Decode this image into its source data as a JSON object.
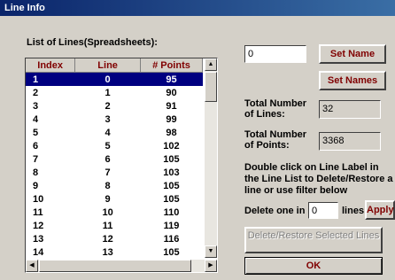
{
  "window": {
    "title": "Line Info"
  },
  "list": {
    "label": "List of Lines(Spreadsheets):",
    "columns": [
      "Index",
      "Line",
      "# Points"
    ],
    "rows": [
      [
        "1",
        "0",
        "95"
      ],
      [
        "2",
        "1",
        "90"
      ],
      [
        "3",
        "2",
        "91"
      ],
      [
        "4",
        "3",
        "99"
      ],
      [
        "5",
        "4",
        "98"
      ],
      [
        "6",
        "5",
        "102"
      ],
      [
        "7",
        "6",
        "105"
      ],
      [
        "8",
        "7",
        "103"
      ],
      [
        "9",
        "8",
        "105"
      ],
      [
        "10",
        "9",
        "105"
      ],
      [
        "11",
        "10",
        "110"
      ],
      [
        "12",
        "11",
        "119"
      ],
      [
        "13",
        "12",
        "116"
      ],
      [
        "14",
        "13",
        "105"
      ]
    ],
    "selected_row": 0
  },
  "name_field": {
    "value": "0"
  },
  "buttons": {
    "set_name": "Set Name",
    "set_names": "Set Names",
    "apply": "Apply",
    "delete_restore": "Delete/Restore Selected Lines",
    "ok": "OK"
  },
  "totals": {
    "lines_label": "Total Number of Lines:",
    "lines_value": "32",
    "points_label": "Total Number of Points:",
    "points_value": "3368"
  },
  "instructions": "Double click on Line Label in the Line List to Delete/Restore a line or use filter below",
  "filter": {
    "prefix": "Delete one in",
    "value": "0",
    "suffix": "lines"
  }
}
